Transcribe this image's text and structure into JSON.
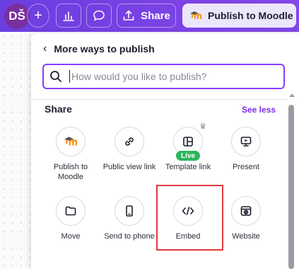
{
  "toolbar": {
    "avatar_initials": "DŠ",
    "share_label": "Share",
    "publish_label": "Publish to Moodle"
  },
  "panel": {
    "title": "More ways to publish",
    "search_placeholder": "How would you like to publish?",
    "section_title": "Share",
    "see_less": "See less",
    "live_badge": "Live",
    "items": [
      {
        "label": "Publish to Moodle",
        "icon": "moodle-icon"
      },
      {
        "label": "Public view link",
        "icon": "link-icon"
      },
      {
        "label": "Template link",
        "icon": "template-icon"
      },
      {
        "label": "Present",
        "icon": "present-icon"
      },
      {
        "label": "Move",
        "icon": "folder-icon"
      },
      {
        "label": "Send to phone",
        "icon": "phone-icon"
      },
      {
        "label": "Embed",
        "icon": "code-icon"
      },
      {
        "label": "Website",
        "icon": "website-icon"
      }
    ]
  },
  "colors": {
    "accent": "#8b3dff",
    "see_less": "#7d2ae8",
    "highlight": "#e0393e",
    "live": "#2fb55c"
  }
}
